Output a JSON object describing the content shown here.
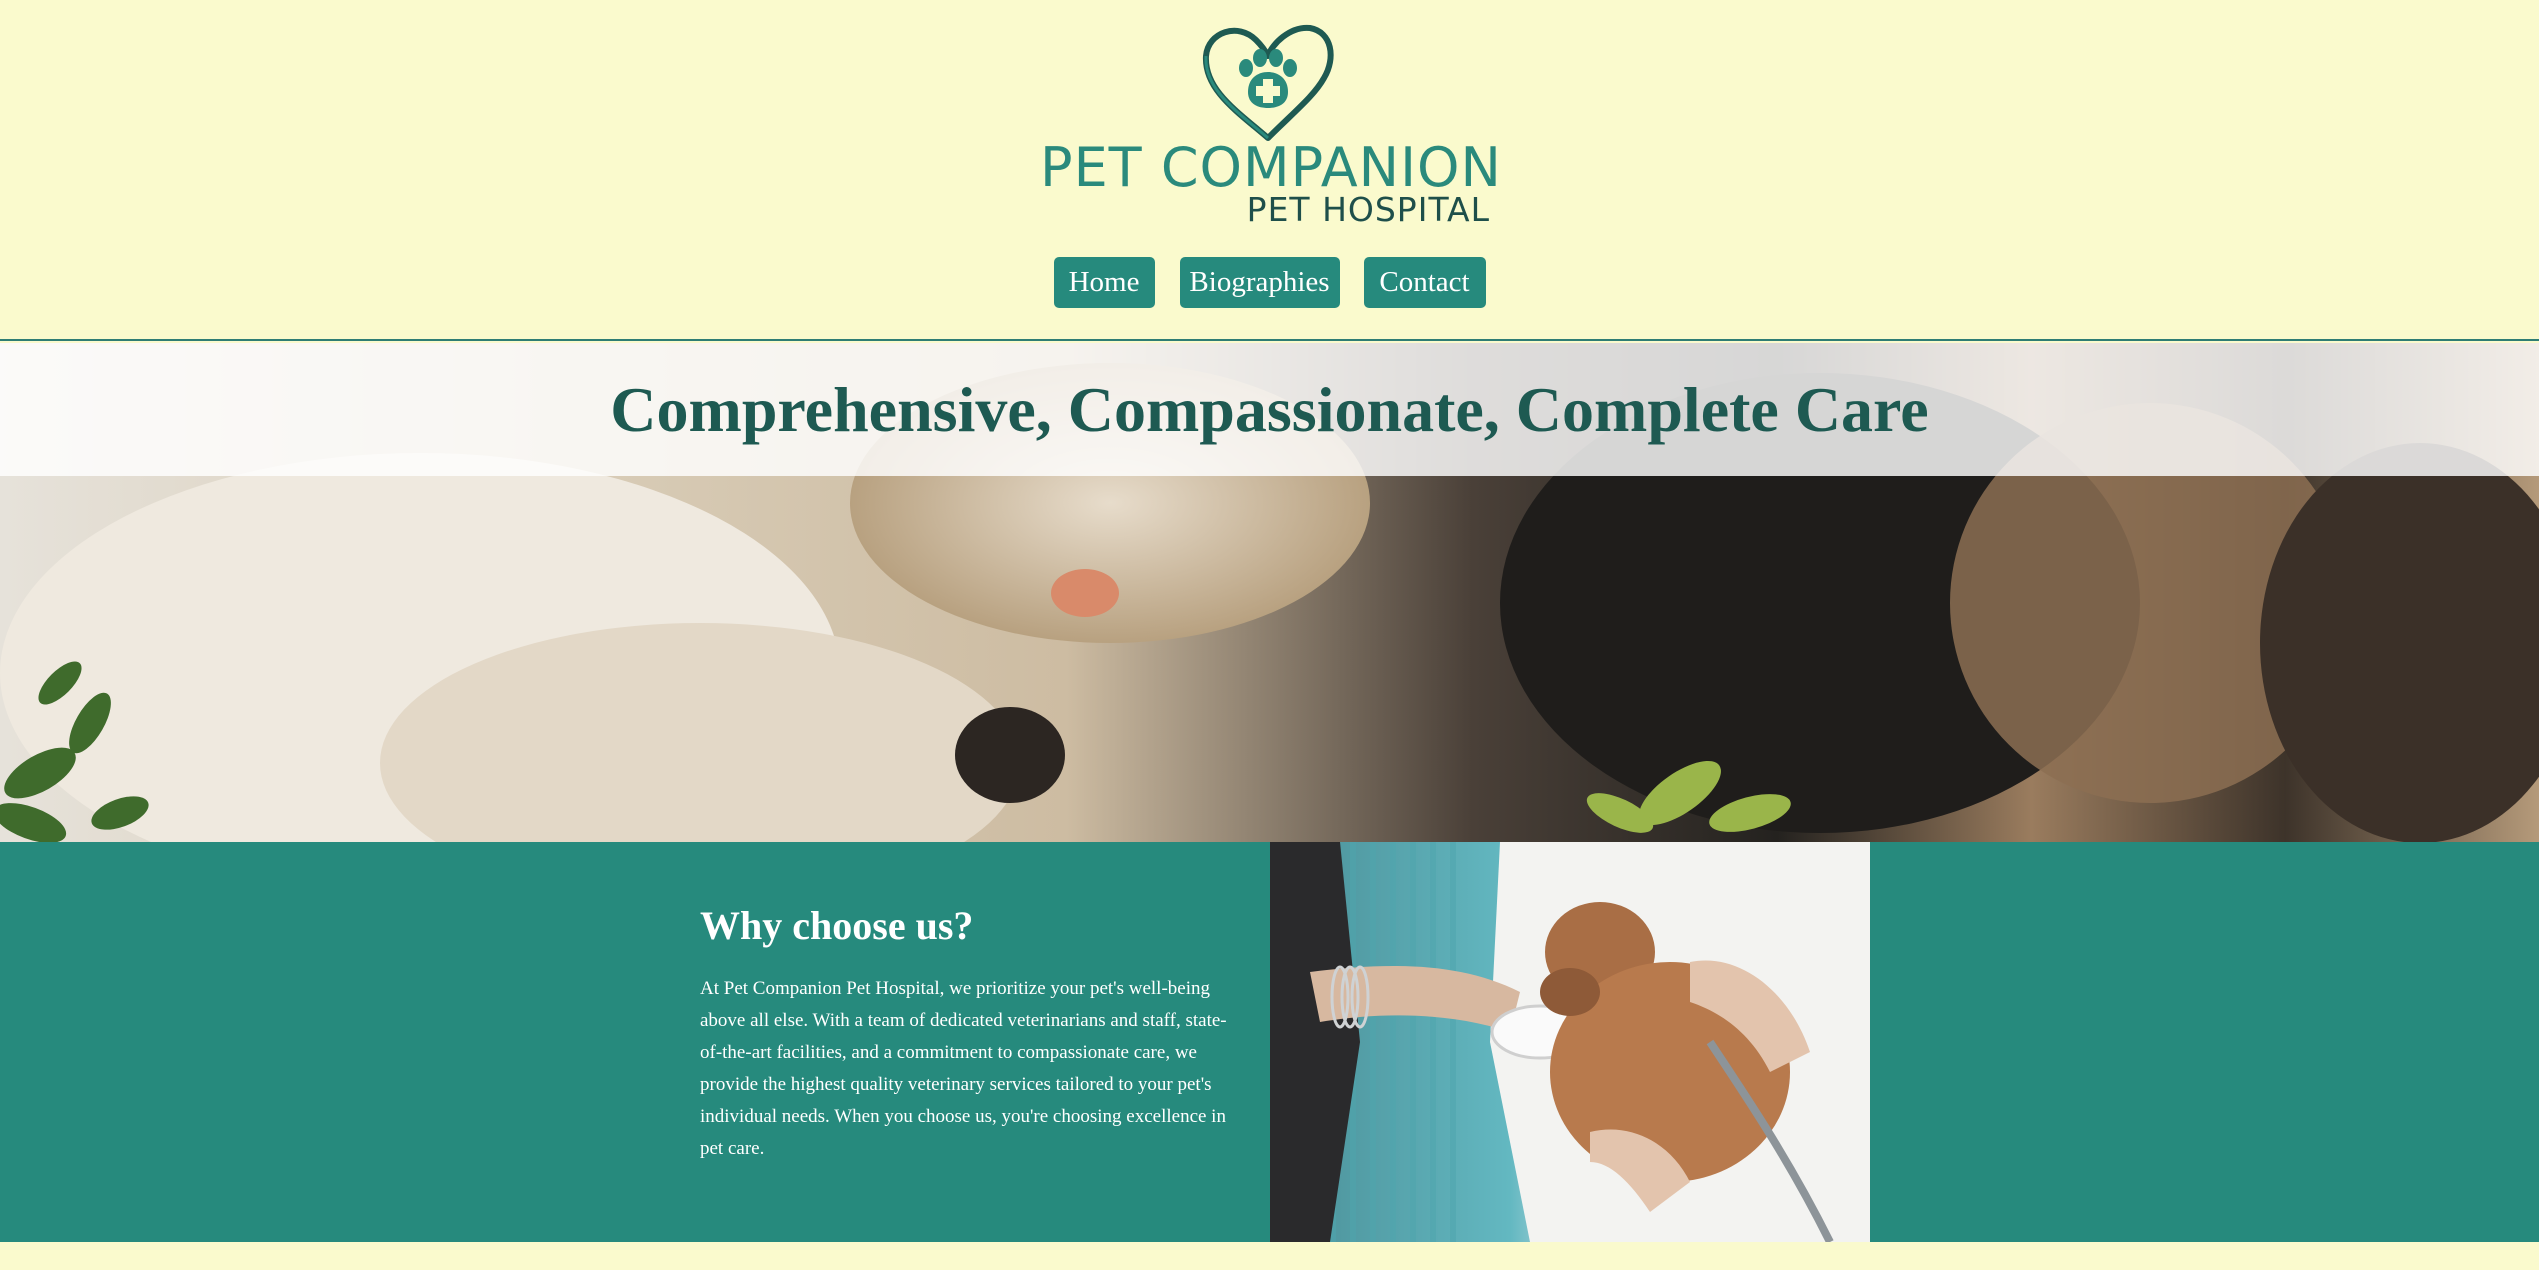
{
  "logo": {
    "line1": "PET COMPANION",
    "line2": "PET HOSPITAL",
    "icon": "heart-paw-cross-icon"
  },
  "nav": {
    "home": "Home",
    "biographies": "Biographies",
    "contact": "Contact"
  },
  "hero": {
    "title": "Comprehensive, Compassionate, Complete Care"
  },
  "why": {
    "heading": "Why choose us?",
    "body": "At Pet Companion Pet Hospital, we prioritize your pet's well-being above all else. With a team of dedicated veterinarians and staff, state-of-the-art facilities, and a commitment to compassionate care, we provide the highest quality veterinary services tailored to your pet's individual needs. When you choose us, you're choosing excellence in pet care."
  },
  "colors": {
    "background": "#fafacd",
    "primary": "#268a7d",
    "dark_teal": "#1e5a52",
    "text_light": "#ffffff"
  }
}
